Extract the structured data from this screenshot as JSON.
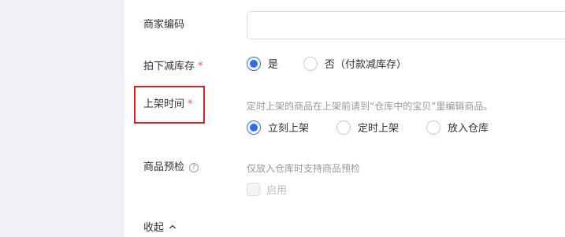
{
  "form": {
    "merchant_code": {
      "label": "商家编码",
      "value": "",
      "placeholder": ""
    },
    "stock_deduct": {
      "label": "拍下减库存",
      "required_mark": "*",
      "options": [
        {
          "label": "是",
          "checked": true
        },
        {
          "label": "否（付款减库存）",
          "checked": false
        }
      ]
    },
    "listing_time": {
      "label": "上架时间",
      "required_mark": "*",
      "hint": "定时上架的商品在上架前请到“仓库中的宝贝”里编辑商品。",
      "options": [
        {
          "label": "立刻上架",
          "checked": true
        },
        {
          "label": "定时上架",
          "checked": false
        },
        {
          "label": "放入仓库",
          "checked": false
        }
      ]
    },
    "presale_check": {
      "label": "商品预检",
      "help_icon": "?",
      "hint": "仅放入仓库时支持商品预检",
      "checkbox_label": "启用",
      "checkbox_checked": false,
      "checkbox_disabled": true
    },
    "collapse_label": "收起"
  },
  "colors": {
    "primary": "#2b6cf6",
    "required": "#ff4d4f",
    "highlight": "#e02020",
    "hint": "#999999"
  },
  "icons": {
    "help": "question-circle-icon",
    "collapse": "chevron-up-icon"
  }
}
